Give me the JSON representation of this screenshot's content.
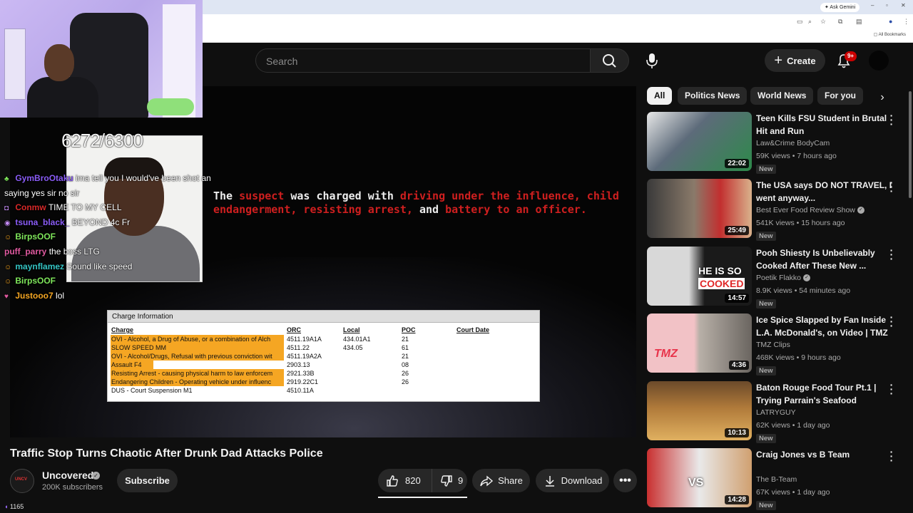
{
  "browser": {
    "gemini_label": "✦ Ask Gemini",
    "bookmarks_label": "All Bookmarks"
  },
  "topbar": {
    "search_placeholder": "Search",
    "create_label": "Create",
    "notification_count": "9+"
  },
  "video": {
    "overlay_text_prefix": "The",
    "overlay_text_suspect": "suspect",
    "overlay_text_mid": "was charged with",
    "overlay_text_charges": "driving under the influence, child endangerment, resisting arrest,",
    "overlay_text_and": "and",
    "overlay_text_battery": "battery to an officer.",
    "mugshot_number": "6272/6300",
    "charge_panel": {
      "heading": "Charge Information",
      "columns": [
        "Charge",
        "ORC",
        "Local",
        "POC",
        "Court Date"
      ],
      "rows": [
        {
          "charge": "OVI - Alcohol, a Drug of Abuse, or a combination of Alch",
          "orc": "4511.19A1A",
          "local": "434.01A1",
          "poc": "21"
        },
        {
          "charge": "SLOW SPEED  MM",
          "orc": "4511.22",
          "local": "434.05",
          "poc": "61"
        },
        {
          "charge": "OVI - Alcohol/Drugs, Refusal with previous conviction wit",
          "orc": "4511.19A2A",
          "local": "",
          "poc": "21"
        },
        {
          "charge": "Assault  F4",
          "orc": "2903.13",
          "local": "",
          "poc": "08"
        },
        {
          "charge": "Resisting Arrest - causing physical harm to law enforcem",
          "orc": "2921.33B",
          "local": "",
          "poc": "26"
        },
        {
          "charge": "Endangering Children - Operating vehicle under influenc",
          "orc": "2919.22C1",
          "local": "",
          "poc": "26"
        },
        {
          "charge": "DUS - Court Suspension  M1",
          "orc": "4510.11A",
          "local": "",
          "poc": ""
        }
      ]
    }
  },
  "chat": [
    {
      "user": "GymBroOtaku",
      "color": "#8a5cf6",
      "message": "ima tell you I would've been shot and I'd be"
    },
    {
      "user": "",
      "color": "#ffffff",
      "message": "saying yes sir no sir"
    },
    {
      "user": "Conmw",
      "color": "#d62828",
      "message": "TIME TO MY CELL"
    },
    {
      "user": "tsuna_black_",
      "color": "#8a5cf6",
      "message": "BEYOND 4c Fr"
    },
    {
      "user": "BirpsOOF",
      "color": "#7fe65b",
      "message": ""
    },
    {
      "user": "puff_parry",
      "color": "#e05aa0",
      "message": "the boss LTG"
    },
    {
      "user": "maynflamez",
      "color": "#34c3c3",
      "message": "Sound like speed"
    },
    {
      "user": "BirpsOOF",
      "color": "#7fe65b",
      "message": ""
    },
    {
      "user": "Justooo7",
      "color": "#f5a623",
      "message": "lol"
    }
  ],
  "info": {
    "title": "Traffic Stop Turns Chaotic After Drunk Dad Attacks Police",
    "channel": "Uncovered",
    "subscribers": "200K subscribers",
    "subscribe_label": "Subscribe",
    "likes": "820",
    "dislikes": "9",
    "share_label": "Share",
    "download_label": "Download",
    "viewer_count": "1165"
  },
  "chips": [
    "All",
    "Politics News",
    "World News",
    "For you"
  ],
  "recommendations": [
    {
      "title": "Teen Kills FSU Student in Brutal Hit and Run",
      "channel": "Law&Crime BodyCam",
      "verified": false,
      "meta": "59K views • 7 hours ago",
      "badge": "New",
      "duration": "22:02",
      "thumb_color": "#5d6b7a",
      "thumb_accent": "#2d8a4a"
    },
    {
      "title": "The USA says DO NOT TRAVEL, I went anyway...",
      "channel": "Best Ever Food Review Show",
      "verified": true,
      "meta": "541K views • 15 hours ago",
      "badge": "New",
      "duration": "25:49",
      "thumb_color": "#8a7a6a",
      "thumb_accent": "#c22f2f"
    },
    {
      "title": "Pooh Shiesty Is Unbelievably Cooked After These New ...",
      "channel": "Poetik Flakko",
      "verified": true,
      "meta": "8.9K views • 54 minutes ago",
      "badge": "New",
      "duration": "14:57",
      "thumb_color": "#d8d8d8",
      "thumb_accent": "#e02828"
    },
    {
      "title": "Ice Spice Slapped by Fan Inside L.A. McDonald's, on Video | TMZ",
      "channel": "TMZ Clips",
      "verified": false,
      "meta": "468K views • 9 hours ago",
      "badge": "New",
      "duration": "4:36",
      "thumb_color": "#b8b0a8",
      "thumb_accent": "#e8334a"
    },
    {
      "title": "Baton Rouge Food Tour Pt.1 | Trying Parrain's Seafood",
      "channel": "LATRYGUY",
      "verified": false,
      "meta": "62K views • 1 day ago",
      "badge": "New",
      "duration": "10:13",
      "thumb_color": "#b07a3a",
      "thumb_accent": "#e0b060"
    },
    {
      "title": "Craig Jones vs B Team",
      "channel": "The B-Team",
      "verified": false,
      "meta": "67K views • 1 day ago",
      "badge": "New",
      "duration": "14:28",
      "thumb_color": "#c93030",
      "thumb_accent": "#f2f2f2"
    }
  ],
  "colors": {
    "accent_red": "#cc0000",
    "highlight_orange": "#f5a623",
    "background": "#0f0f0f"
  }
}
